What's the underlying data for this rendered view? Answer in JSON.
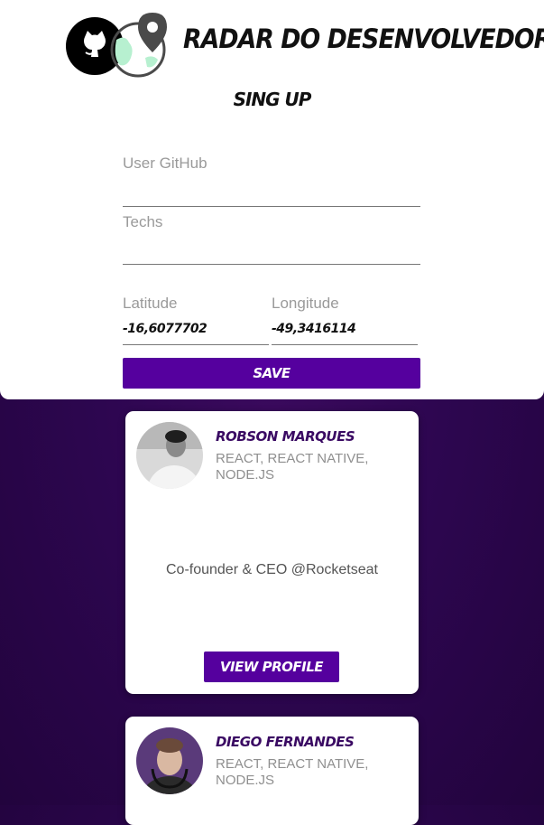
{
  "app": {
    "title": "RADAR DO DESENVOLVEDOR"
  },
  "form": {
    "title": "SING UP",
    "github_label": "User GitHub",
    "techs_label": "Techs",
    "latitude_label": "Latitude",
    "latitude_value": "-16,6077702",
    "longitude_label": "Longitude",
    "longitude_value": "-49,3416114",
    "save_label": "SAVE"
  },
  "devs": [
    {
      "name": "ROBSON MARQUES",
      "techs": "REACT, REACT NATIVE, NODE.JS",
      "bio": "Co-founder & CEO @Rocketseat",
      "button_label": "VIEW PROFILE"
    },
    {
      "name": "DIEGO FERNANDES",
      "techs": "REACT, REACT NATIVE, NODE.JS"
    }
  ],
  "colors": {
    "accent": "#55009e",
    "name": "#3a0a63",
    "background": "#2d0650",
    "logo_green": "#b7f0d0",
    "logo_gray": "#4a4a4a"
  },
  "icons": {
    "logo": [
      "github-icon",
      "map-pin-icon",
      "globe-icon"
    ]
  }
}
